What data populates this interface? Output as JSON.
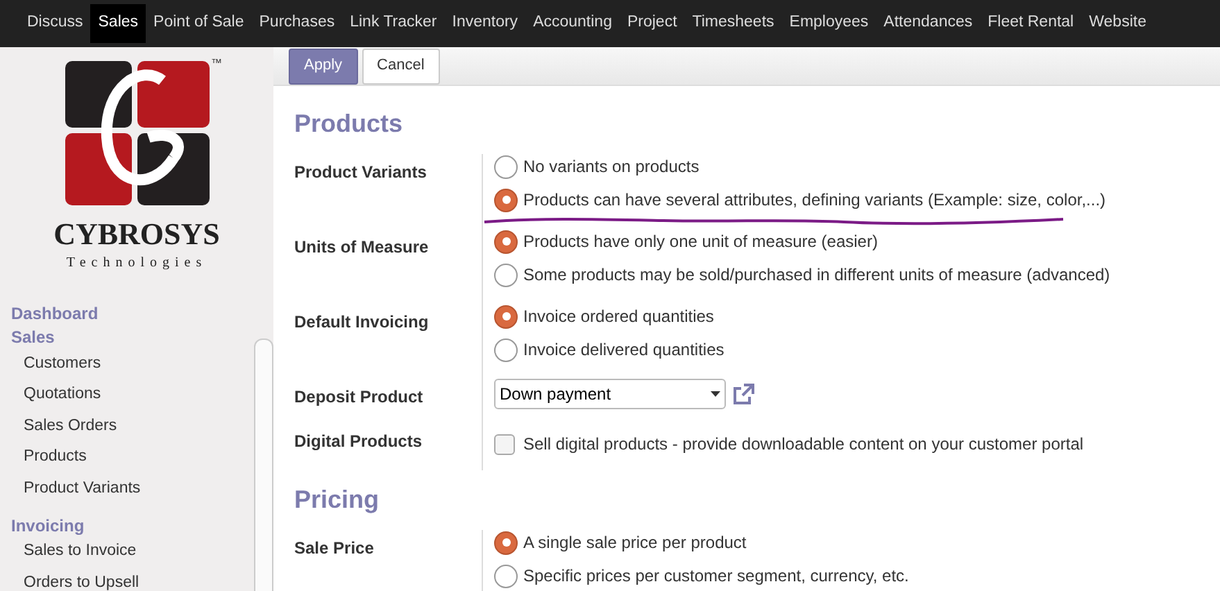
{
  "top_menu": [
    {
      "label": "Discuss",
      "selected": false
    },
    {
      "label": "Sales",
      "selected": true
    },
    {
      "label": "Point of Sale",
      "selected": false
    },
    {
      "label": "Purchases",
      "selected": false
    },
    {
      "label": "Link Tracker",
      "selected": false
    },
    {
      "label": "Inventory",
      "selected": false
    },
    {
      "label": "Accounting",
      "selected": false
    },
    {
      "label": "Project",
      "selected": false
    },
    {
      "label": "Timesheets",
      "selected": false
    },
    {
      "label": "Employees",
      "selected": false
    },
    {
      "label": "Attendances",
      "selected": false
    },
    {
      "label": "Fleet Rental",
      "selected": false
    },
    {
      "label": "Website",
      "selected": false
    }
  ],
  "logo": {
    "trademark": "™",
    "name": "CYBROSYS",
    "tagline": "Technologies"
  },
  "sidebar": [
    {
      "kind": "heading",
      "label": "Dashboard"
    },
    {
      "kind": "heading",
      "label": "Sales"
    },
    {
      "kind": "item",
      "label": "Customers"
    },
    {
      "kind": "item",
      "label": "Quotations"
    },
    {
      "kind": "item",
      "label": "Sales Orders"
    },
    {
      "kind": "item",
      "label": "Products"
    },
    {
      "kind": "item",
      "label": "Product Variants"
    },
    {
      "kind": "heading",
      "label": "Invoicing"
    },
    {
      "kind": "item",
      "label": "Sales to Invoice"
    },
    {
      "kind": "item",
      "label": "Orders to Upsell"
    }
  ],
  "buttons": [
    {
      "label": "Apply",
      "kind": "primary"
    },
    {
      "label": "Cancel",
      "kind": "secondary"
    }
  ],
  "sections": [
    {
      "title": "Products",
      "settings": [
        {
          "label": "Product Variants",
          "kind": "radio",
          "underlined": true,
          "options": [
            {
              "label": "No variants on products",
              "selected": false
            },
            {
              "label": "Products can have several attributes, defining variants (Example: size, color,...)",
              "selected": true
            }
          ]
        },
        {
          "label": "Units of Measure",
          "kind": "radio",
          "underlined": false,
          "options": [
            {
              "label": "Products have only one unit of measure (easier)",
              "selected": true
            },
            {
              "label": "Some products may be sold/purchased in different units of measure (advanced)",
              "selected": false
            }
          ]
        },
        {
          "label": "Default Invoicing",
          "kind": "radio",
          "underlined": false,
          "options": [
            {
              "label": "Invoice ordered quantities",
              "selected": true
            },
            {
              "label": "Invoice delivered quantities",
              "selected": false
            }
          ]
        },
        {
          "label": "Deposit Product",
          "kind": "select",
          "value": "Down payment"
        },
        {
          "label": "Digital Products",
          "kind": "checkbox",
          "checked": false,
          "text": "Sell digital products - provide downloadable content on your customer portal"
        }
      ]
    },
    {
      "title": "Pricing",
      "settings": [
        {
          "label": "Sale Price",
          "kind": "radio",
          "underlined": false,
          "options": [
            {
              "label": "A single sale price per product",
              "selected": true
            },
            {
              "label": "Specific prices per customer segment, currency, etc.",
              "selected": false
            }
          ]
        }
      ]
    }
  ]
}
